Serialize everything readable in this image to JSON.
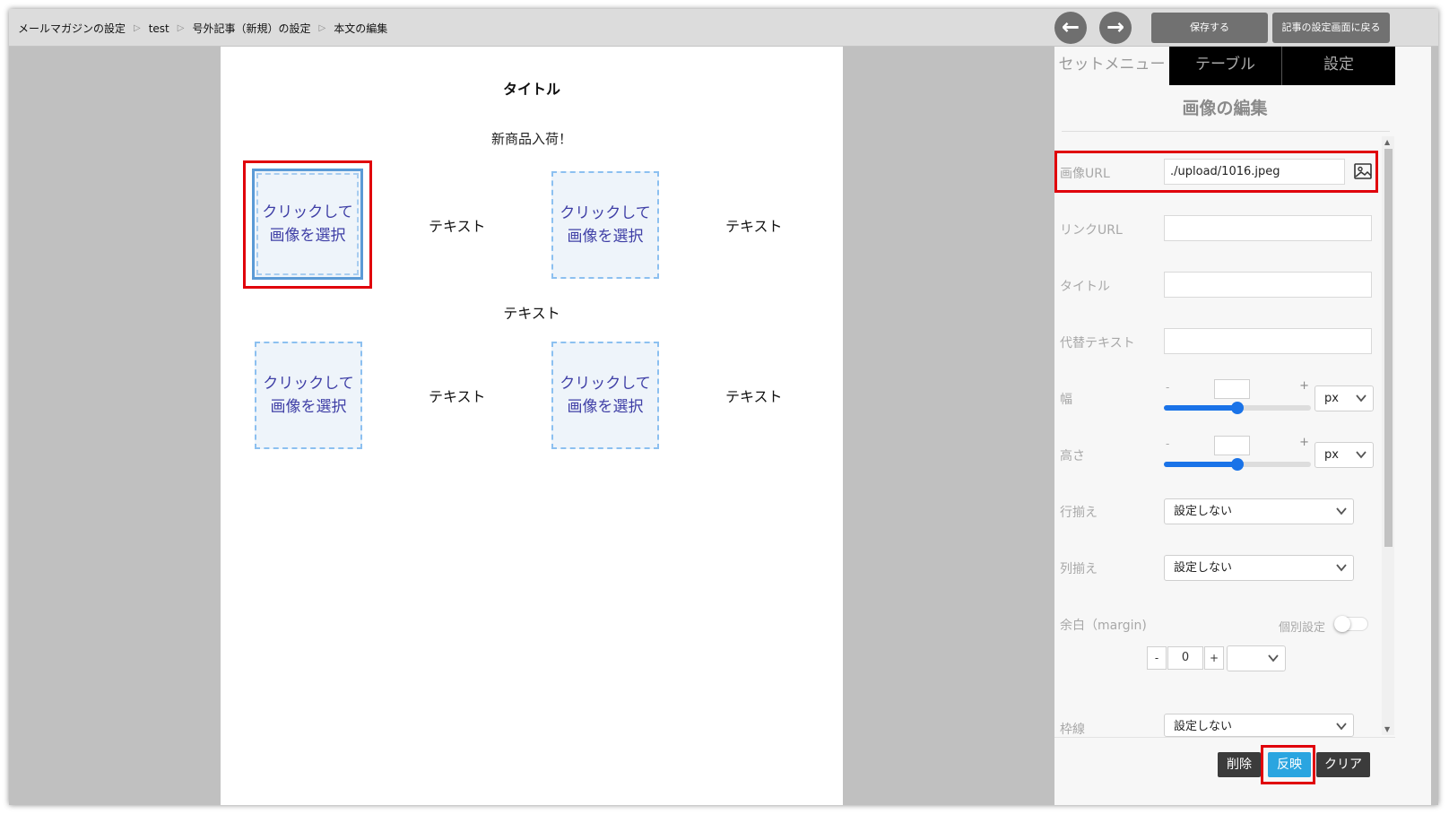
{
  "breadcrumb": [
    "メールマガジンの設定",
    "test",
    "号外記事（新規）の設定",
    "本文の編集"
  ],
  "toolbar": {
    "back_icon": "arrow-left-icon",
    "forward_icon": "arrow-right-icon",
    "save_label": "保存する",
    "return_label": "記事の設定画面に戻る"
  },
  "canvas": {
    "title": "タイトル",
    "subtitle": "新商品入荷！",
    "image_placeholder_line1": "クリックして",
    "image_placeholder_line2": "画像を選択",
    "text_label": "テキスト"
  },
  "panel": {
    "tabs": [
      "セットメニュー",
      "テーブル",
      "設定"
    ],
    "title": "画像の編集",
    "fields": {
      "image_url_label": "画像URL",
      "image_url_value": "./upload/1016.jpeg",
      "link_url_label": "リンクURL",
      "title_label": "タイトル",
      "alt_label": "代替テキスト",
      "width_label": "幅",
      "height_label": "高さ",
      "row_align_label": "行揃え",
      "col_align_label": "列揃え",
      "margin_label": "余白（margin)",
      "individual_label": "個別設定",
      "border_label": "枠線"
    },
    "unit": "px",
    "not_set": "設定しない",
    "minus": "-",
    "plus": "+",
    "margin_value": "0",
    "width_slider_fraction": 0.5,
    "height_slider_fraction": 0.5
  },
  "footer": {
    "delete_label": "削除",
    "apply_label": "反映",
    "clear_label": "クリア"
  },
  "colors": {
    "highlight": "#e0000b",
    "apply_button": "#2aa5e0",
    "slider": "#1a73e8"
  }
}
